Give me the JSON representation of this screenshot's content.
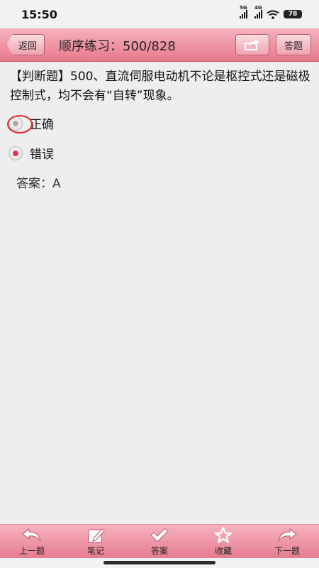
{
  "status_bar": {
    "time": "15:50",
    "signal1_tag": "5G",
    "signal2_tag": "4G",
    "battery": "78"
  },
  "header": {
    "back_label": "返回",
    "title": "顺序练习：500/828",
    "answer_button_label": "答题",
    "share_icon": "share-icon"
  },
  "question": {
    "text": "【判断题】500、直流伺服电动机不论是枢控式还是磁极控制式，均不会有“自转”现象。",
    "options": [
      {
        "label": "正确",
        "selected": false,
        "circled": true
      },
      {
        "label": "错误",
        "selected": true,
        "circled": false
      }
    ],
    "answer_line": "答案：A"
  },
  "toolbar": {
    "items": [
      {
        "label": "上一题",
        "icon": "undo-arrow-icon"
      },
      {
        "label": "笔记",
        "icon": "edit-note-icon"
      },
      {
        "label": "答案",
        "icon": "checkmark-icon"
      },
      {
        "label": "收藏",
        "icon": "star-icon"
      },
      {
        "label": "下一题",
        "icon": "redo-arrow-icon"
      }
    ]
  },
  "colors": {
    "header_pink": "#e8798c",
    "radio_selected": "#d8394f",
    "circle_annotation": "#d72b2b"
  }
}
